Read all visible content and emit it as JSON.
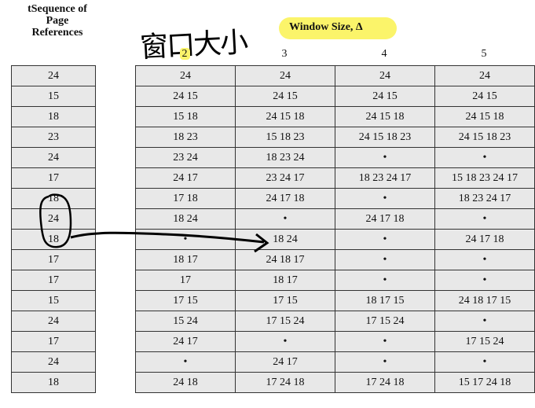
{
  "seq_header": "tSequence of\nPage\nReferences",
  "window_title": "Window Size, Δ",
  "handwritten_note": "窗口大小",
  "window_sizes": [
    "2",
    "3",
    "4",
    "5"
  ],
  "sequence": [
    "24",
    "15",
    "18",
    "23",
    "24",
    "17",
    "18",
    "24",
    "18",
    "17",
    "17",
    "15",
    "24",
    "17",
    "24",
    "18"
  ],
  "rows": [
    [
      "24",
      "24",
      "24",
      "24"
    ],
    [
      "24 15",
      "24 15",
      "24 15",
      "24 15"
    ],
    [
      "15 18",
      "24 15 18",
      "24 15 18",
      "24 15 18"
    ],
    [
      "18 23",
      "15 18 23",
      "24 15 18 23",
      "24 15 18 23"
    ],
    [
      "23 24",
      "18 23 24",
      "•",
      "•"
    ],
    [
      "24 17",
      "23 24 17",
      "18 23 24 17",
      "15 18 23 24 17"
    ],
    [
      "17 18",
      "24 17 18",
      "•",
      "18 23 24 17"
    ],
    [
      "18 24",
      "•",
      "24 17 18",
      "•"
    ],
    [
      "•",
      "18 24",
      "•",
      "24 17 18"
    ],
    [
      "18 17",
      "24 18 17",
      "•",
      "•"
    ],
    [
      "17",
      "18 17",
      "•",
      "•"
    ],
    [
      "17 15",
      "17 15",
      "18 17 15",
      "24 18 17 15"
    ],
    [
      "15 24",
      "17 15 24",
      "17 15 24",
      "•"
    ],
    [
      "24 17",
      "•",
      "•",
      "17 15 24"
    ],
    [
      "•",
      "24 17",
      "•",
      "•"
    ],
    [
      "24 18",
      "17 24 18",
      "17 24 18",
      "15 17 24 18"
    ]
  ]
}
